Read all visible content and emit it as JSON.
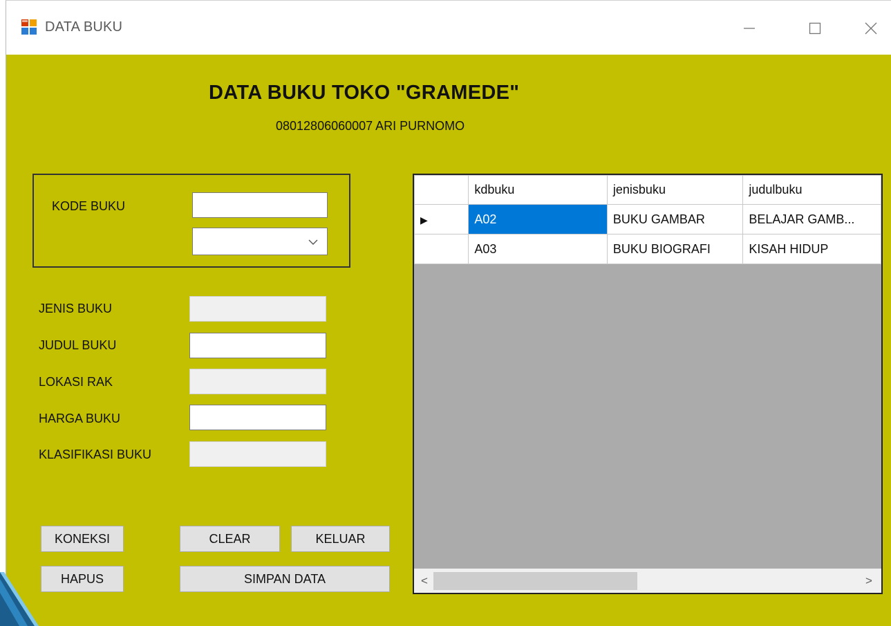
{
  "window": {
    "title": "DATA BUKU"
  },
  "header": {
    "title": "DATA BUKU TOKO \"GRAMEDE\"",
    "subtitle": "08012806060007  ARI PURNOMO"
  },
  "form": {
    "kode_buku_label": "KODE BUKU",
    "kode_buku_value": "",
    "kode_buku_combo_value": "",
    "jenis_buku_label": "JENIS BUKU",
    "judul_buku_label": "JUDUL BUKU",
    "lokasi_rak_label": "LOKASI RAK",
    "harga_buku_label": "HARGA BUKU",
    "klasifikasi_buku_label": "KLASIFIKASI BUKU"
  },
  "buttons": {
    "koneksi": "KONEKSI",
    "clear": "CLEAR",
    "keluar": "KELUAR",
    "hapus": "HAPUS",
    "simpan": "SIMPAN DATA"
  },
  "grid": {
    "columns": [
      "kdbuku",
      "jenisbuku",
      "judulbuku"
    ],
    "rows": [
      {
        "kdbuku": "A02",
        "jenisbuku": "BUKU GAMBAR",
        "judulbuku": "BELAJAR GAMB..."
      },
      {
        "kdbuku": "A03",
        "jenisbuku": "BUKU BIOGRAFI",
        "judulbuku": "KISAH HIDUP"
      }
    ],
    "current_row_marker": "▶",
    "scroll_left": "<",
    "scroll_right": ">"
  },
  "colors": {
    "form_background": "#c2c000",
    "grid_background": "#ababab",
    "selection": "#0078d7"
  },
  "icons": {
    "app": "app-window-icon",
    "minimize": "minimize-icon",
    "maximize": "maximize-icon",
    "close": "close-icon",
    "dropdown": "chevron-down-icon"
  }
}
